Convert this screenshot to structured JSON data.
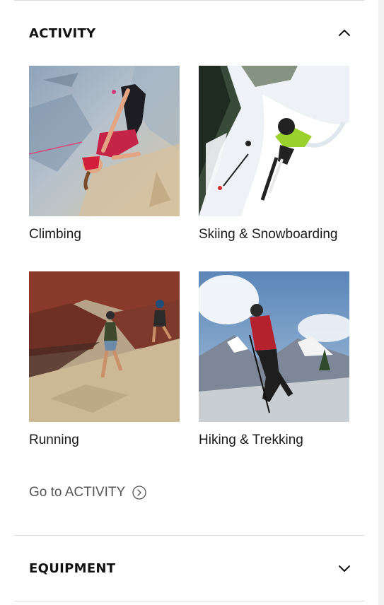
{
  "sections": {
    "activity": {
      "title": "ACTIVITY",
      "expanded": true,
      "items": [
        {
          "label": "Climbing"
        },
        {
          "label": "Skiing & Snowboarding"
        },
        {
          "label": "Running"
        },
        {
          "label": "Hiking & Trekking"
        }
      ],
      "goto_label": "Go to ACTIVITY"
    },
    "equipment": {
      "title": "EQUIPMENT",
      "expanded": false
    }
  },
  "icons": {
    "activity_toggle": "chevron-up-icon",
    "equipment_toggle": "chevron-down-icon",
    "goto": "circle-arrow-right-icon"
  }
}
